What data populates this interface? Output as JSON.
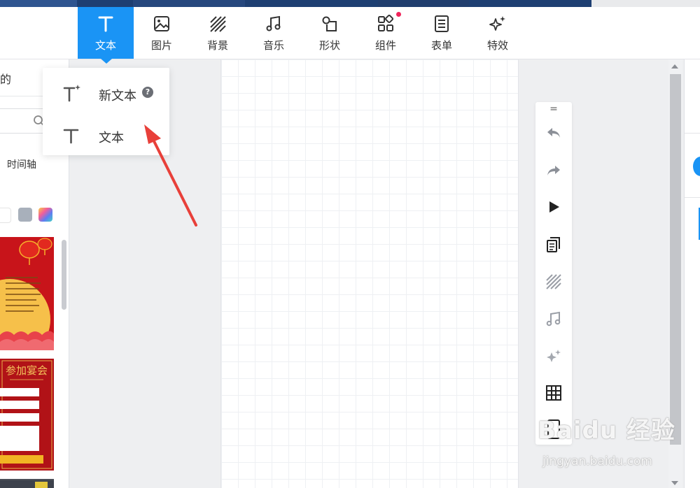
{
  "toolbar": {
    "tools": [
      {
        "label": "文本",
        "icon": "text-icon",
        "active": true
      },
      {
        "label": "图片",
        "icon": "image-icon"
      },
      {
        "label": "背景",
        "icon": "background-icon"
      },
      {
        "label": "音乐",
        "icon": "music-icon"
      },
      {
        "label": "形状",
        "icon": "shape-icon"
      },
      {
        "label": "组件",
        "icon": "component-icon",
        "notification_dot": true
      },
      {
        "label": "表单",
        "icon": "form-icon"
      },
      {
        "label": "特效",
        "icon": "effects-icon"
      }
    ],
    "active_color": "#1a94f5"
  },
  "dropdown": {
    "items": [
      {
        "label": "新文本",
        "icon": "new-text-icon",
        "help": "?"
      },
      {
        "label": "文本",
        "icon": "text-icon"
      }
    ]
  },
  "left_panel": {
    "header_text": "的",
    "tab_label": "时间轴",
    "search_icon": "search-icon",
    "thumbnails": [
      "lantern-poster",
      "banquet-form-poster",
      "dark-poster"
    ]
  },
  "vertical_toolbar": {
    "handle": "=",
    "buttons": [
      "undo-icon",
      "redo-icon",
      "play-icon",
      "pages-icon",
      "background-icon",
      "music-icon",
      "effects-icon",
      "grid-icon",
      "phone-icon"
    ]
  },
  "watermark": {
    "logo": "Baidu 经验",
    "url": "jingyan.baidu.com"
  },
  "colors": {
    "annotation_arrow": "#e8403a",
    "notification_dot": "#f0245a"
  }
}
